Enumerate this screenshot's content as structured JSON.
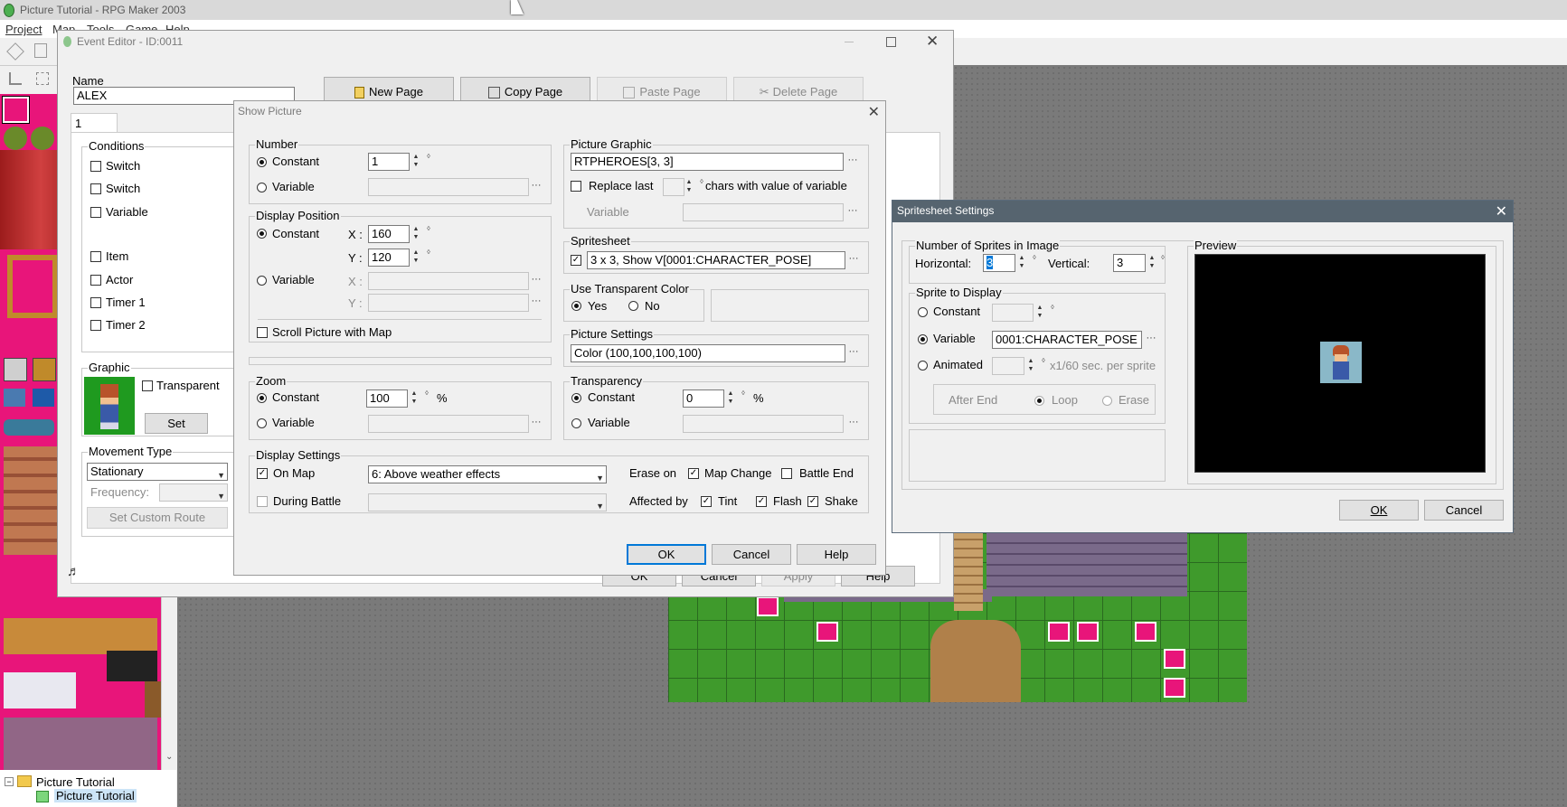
{
  "app": {
    "title": "Picture Tutorial - RPG Maker 2003",
    "menu": [
      "Project",
      "Map",
      "Tools",
      "Game",
      "Help"
    ]
  },
  "map_tree": {
    "root": "Picture Tutorial",
    "child": "Picture Tutorial"
  },
  "event_editor": {
    "title": "Event Editor - ID:0011",
    "name_label": "Name",
    "name_value": "ALEX",
    "page_tab": "1",
    "buttons": {
      "new_page": "New Page",
      "copy_page": "Copy Page",
      "paste_page": "Paste Page",
      "delete_page": "Delete Page"
    },
    "conditions_label": "Conditions",
    "conditions": [
      "Switch",
      "Switch",
      "Variable",
      "Item",
      "Actor",
      "Timer 1",
      "Timer 2"
    ],
    "graphic_label": "Graphic",
    "transparent_label": "Transparent",
    "set_button": "Set",
    "movement_type_label": "Movement Type",
    "movement_type_value": "Stationary",
    "frequency_label": "Frequency:",
    "set_custom_route": "Set Custom Route",
    "ok": "OK",
    "cancel": "Cancel",
    "apply": "Apply",
    "help": "Help"
  },
  "show_picture": {
    "title": "Show Picture",
    "number": {
      "label": "Number",
      "constant_label": "Constant",
      "constant_value": "1",
      "variable_label": "Variable"
    },
    "display_position": {
      "label": "Display Position",
      "constant_label": "Constant",
      "x_label": "X :",
      "x_value": "160",
      "y_label": "Y :",
      "y_value": "120",
      "variable_label": "Variable",
      "var_x_label": "X :",
      "var_y_label": "Y :"
    },
    "scroll_with_map": "Scroll Picture with Map",
    "zoom": {
      "label": "Zoom",
      "constant_label": "Constant",
      "constant_value": "100",
      "unit": "%",
      "variable_label": "Variable"
    },
    "picture_graphic": {
      "label": "Picture Graphic",
      "value": "RTPHEROES[3, 3]",
      "replace_last_label": "Replace last",
      "chars_label": "chars with value of variable",
      "variable_label": "Variable"
    },
    "spritesheet": {
      "label": "Spritesheet",
      "value": "3 x 3, Show V[0001:CHARACTER_POSE]"
    },
    "use_transparent_color": {
      "label": "Use Transparent Color",
      "yes": "Yes",
      "no": "No"
    },
    "picture_settings": {
      "label": "Picture Settings",
      "value": "Color (100,100,100,100)"
    },
    "transparency": {
      "label": "Transparency",
      "constant_label": "Constant",
      "constant_value": "0",
      "unit": "%",
      "variable_label": "Variable"
    },
    "display_settings": {
      "label": "Display Settings",
      "on_map": "On Map",
      "layer_value": "6: Above weather effects",
      "during_battle": "During Battle",
      "erase_on": "Erase on",
      "map_change": "Map Change",
      "battle_end": "Battle End",
      "affected_by": "Affected by",
      "tint": "Tint",
      "flash": "Flash",
      "shake": "Shake"
    },
    "ok": "OK",
    "cancel": "Cancel",
    "help": "Help"
  },
  "spritesheet_settings": {
    "title": "Spritesheet Settings",
    "num_sprites_label": "Number of Sprites in Image",
    "horizontal_label": "Horizontal:",
    "horizontal_value": "3",
    "vertical_label": "Vertical:",
    "vertical_value": "3",
    "sprite_to_display_label": "Sprite to Display",
    "constant_label": "Constant",
    "variable_label": "Variable",
    "variable_value": "0001:CHARACTER_POSE",
    "animated_label": "Animated",
    "animated_suffix": "x1/60 sec. per sprite",
    "after_end_label": "After End",
    "loop_label": "Loop",
    "erase_label": "Erase",
    "preview_label": "Preview",
    "ok": "OK",
    "cancel": "Cancel"
  },
  "colors": {
    "titlebar_inactive": "#f0f0f0",
    "accent": "#0078d7",
    "tile_magenta": "#e8157a",
    "map_grass": "#3f9a2c",
    "preview_bg": "#000000"
  }
}
